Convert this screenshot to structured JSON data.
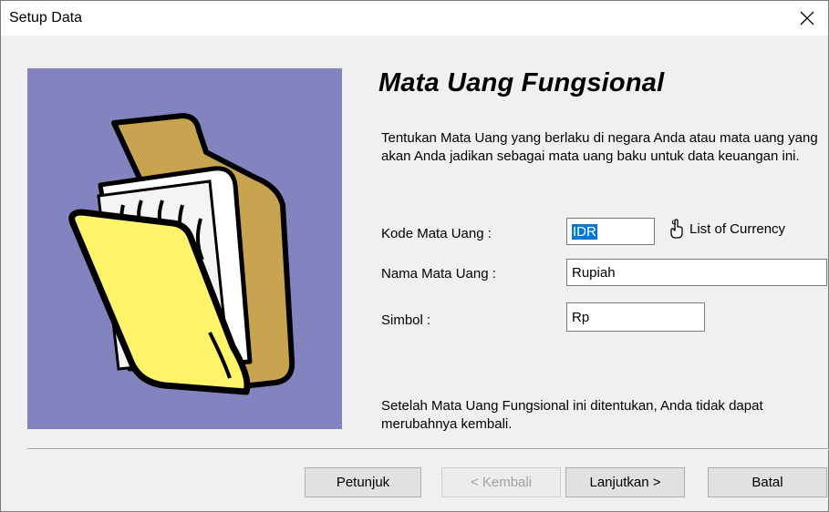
{
  "window": {
    "title": "Setup Data",
    "close_icon": "close-icon"
  },
  "page": {
    "heading": "Mata Uang Fungsional",
    "description": "Tentukan Mata Uang yang berlaku di negara Anda atau mata uang yang akan Anda jadikan sebagai mata uang baku untuk data keuangan ini.",
    "illustration_icon": "folder-with-papers-icon"
  },
  "form": {
    "currency_code": {
      "label": "Kode Mata Uang :",
      "value": "IDR"
    },
    "currency_name": {
      "label": "Nama Mata Uang :",
      "value": "Rupiah"
    },
    "symbol": {
      "label": "Simbol :",
      "value": "Rp"
    },
    "list_link": {
      "label": "List of Currency",
      "icon": "hand-pointer-icon"
    }
  },
  "note": "Setelah Mata Uang Fungsional ini ditentukan, Anda tidak dapat merubahnya kembali.",
  "buttons": {
    "help": "Petunjuk",
    "back": "< Kembali",
    "next": "Lanjutkan >",
    "cancel": "Batal"
  },
  "colors": {
    "art_background": "#8384bf",
    "selection": "#0078d7"
  }
}
